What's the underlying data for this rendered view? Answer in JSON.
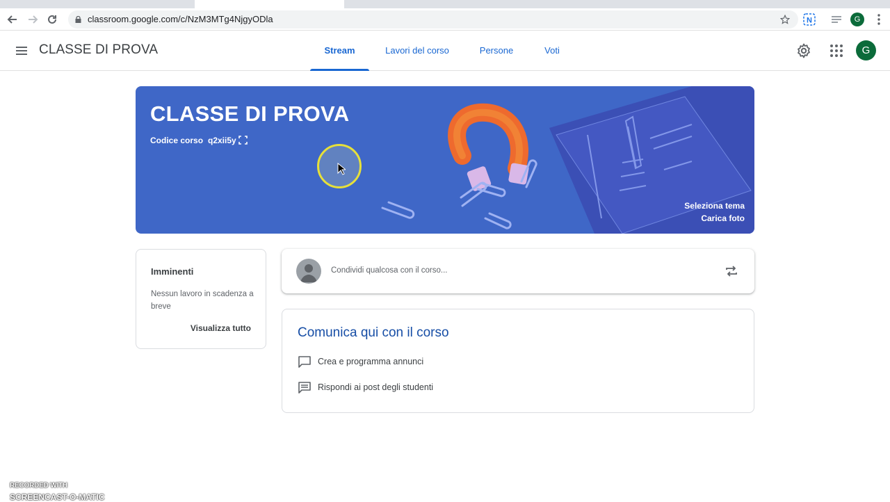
{
  "browser": {
    "url": "classroom.google.com/c/NzM3MTg4NjgyODla",
    "profile_initial": "G"
  },
  "header": {
    "course_title": "CLASSE DI PROVA",
    "tabs": [
      {
        "label": "Stream",
        "active": true
      },
      {
        "label": "Lavori del corso",
        "active": false
      },
      {
        "label": "Persone",
        "active": false
      },
      {
        "label": "Voti",
        "active": false
      }
    ],
    "avatar_initial": "G"
  },
  "banner": {
    "title": "CLASSE DI PROVA",
    "code_label": "Codice corso",
    "code_value": "q2xii5y",
    "select_theme": "Seleziona tema",
    "upload_photo": "Carica foto",
    "color": "#3f67c7"
  },
  "upcoming": {
    "heading": "Imminenti",
    "message": "Nessun lavoro in scadenza a breve",
    "view_all": "Visualizza tutto"
  },
  "share": {
    "placeholder": "Condividi qualcosa con il corso..."
  },
  "communicate": {
    "heading": "Comunica qui con il corso",
    "items": [
      {
        "label": "Crea e programma annunci",
        "icon": "announcement-icon"
      },
      {
        "label": "Rispondi ai post degli studenti",
        "icon": "comment-icon"
      }
    ]
  },
  "watermark": {
    "line1": "RECORDED WITH",
    "line2": "SCREENCAST-O-MATIC"
  },
  "colors": {
    "accent": "#1967d2",
    "heading_blue": "#174ea6",
    "avatar": "#0b6b3a"
  }
}
